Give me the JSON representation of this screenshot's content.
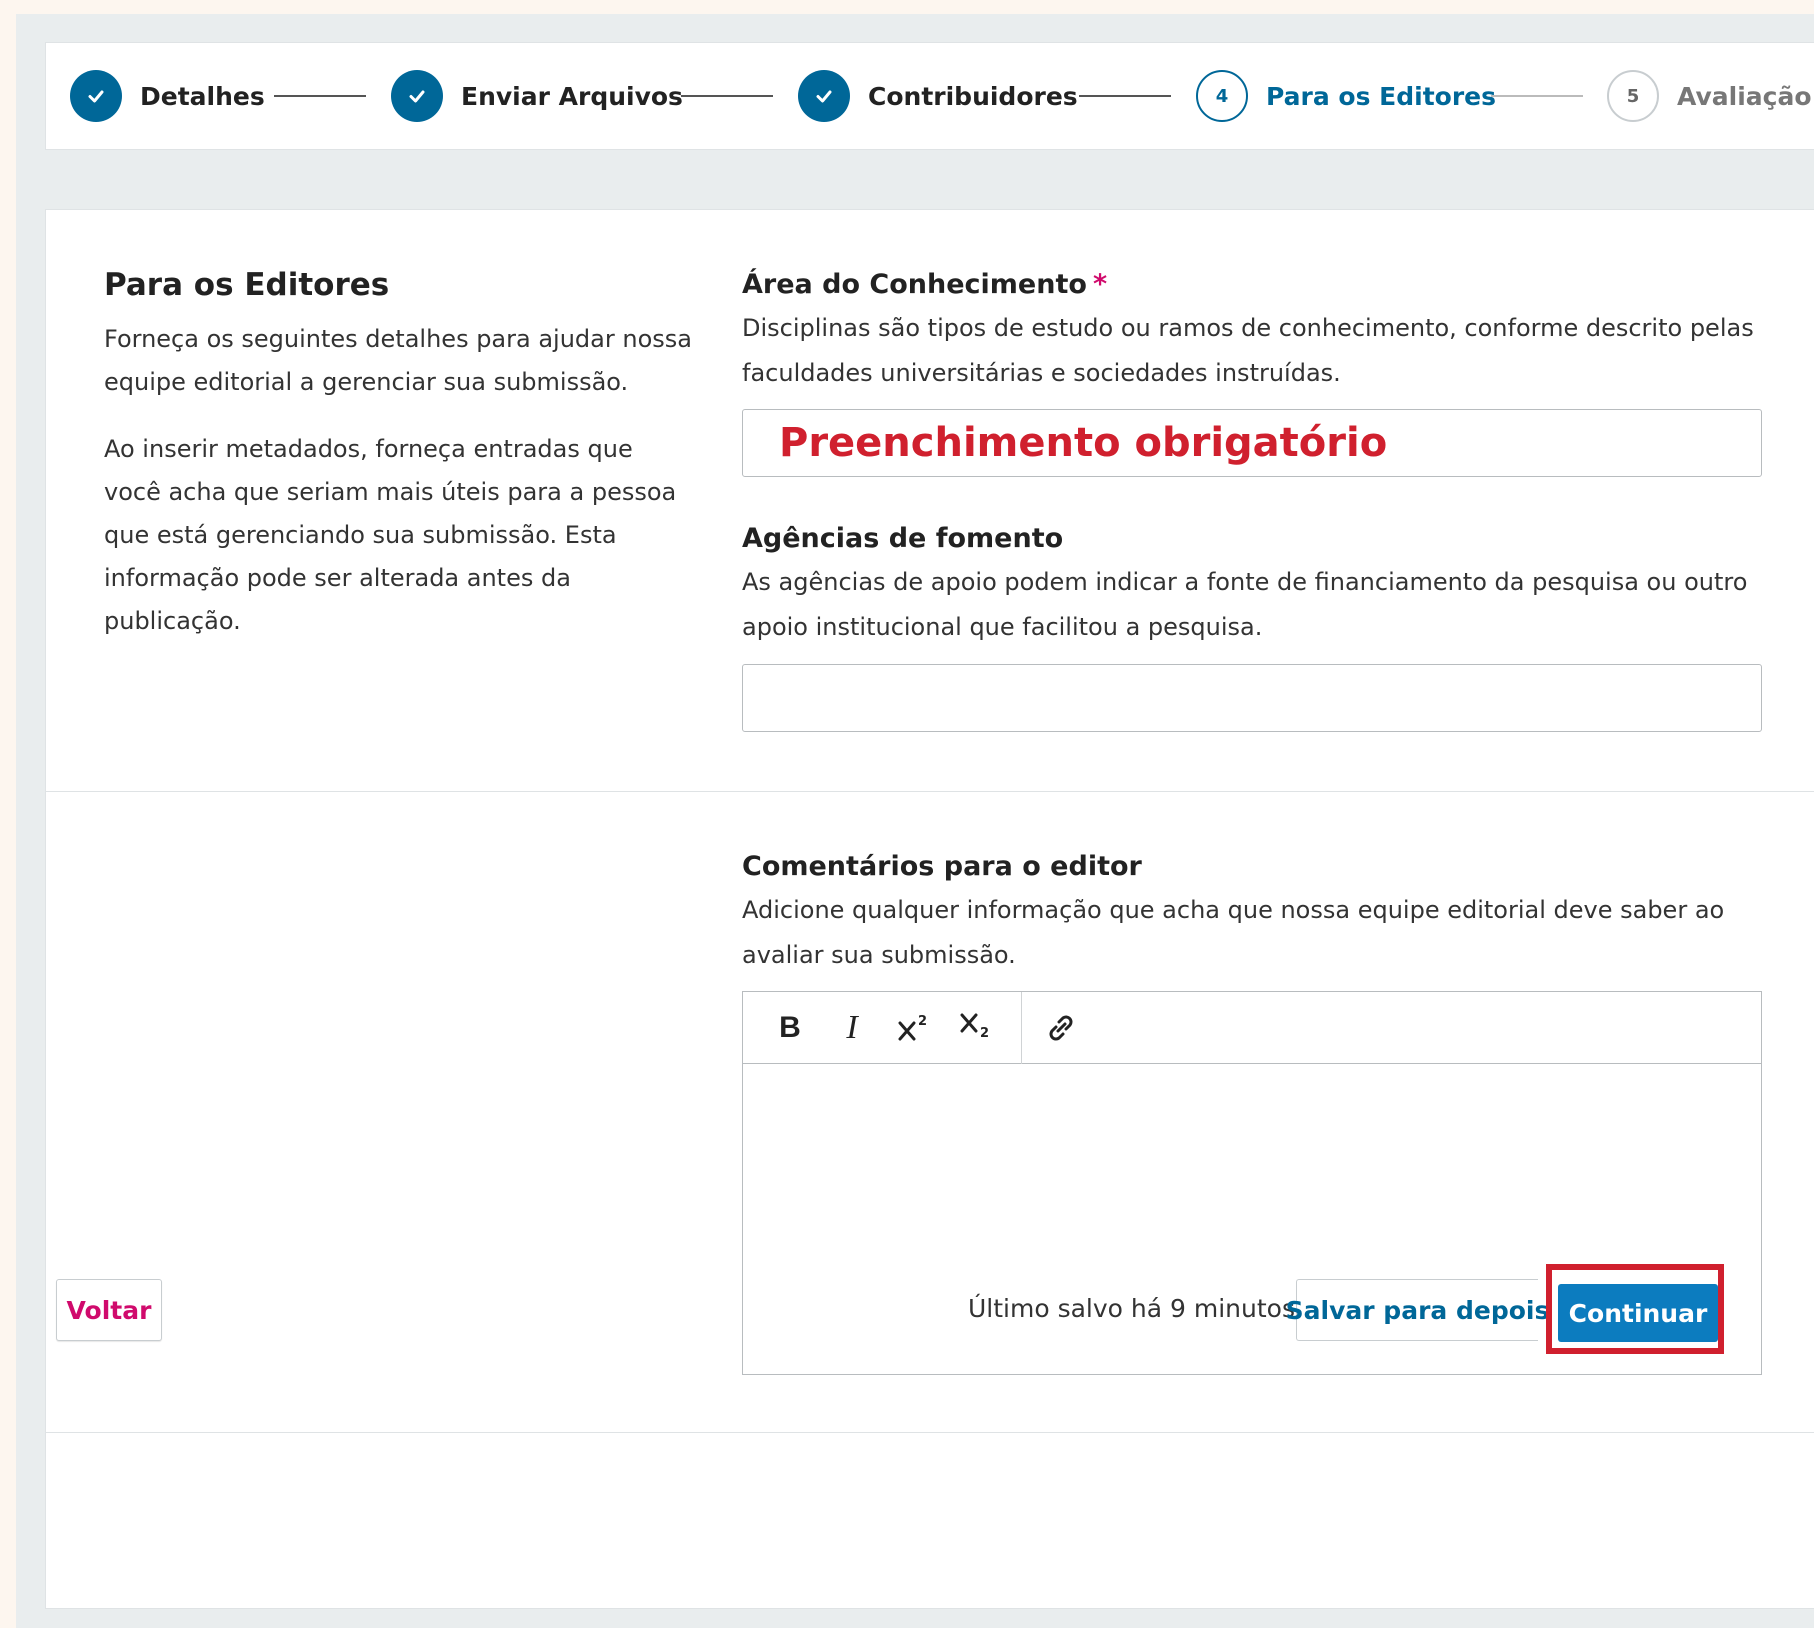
{
  "stepper": {
    "steps": [
      {
        "number": "",
        "label": "Detalhes",
        "state": "done"
      },
      {
        "number": "",
        "label": "Enviar Arquivos",
        "state": "done"
      },
      {
        "number": "",
        "label": "Contribuidores",
        "state": "done"
      },
      {
        "number": "4",
        "label": "Para os Editores",
        "state": "current"
      },
      {
        "number": "5",
        "label": "Avaliação",
        "state": "todo"
      }
    ]
  },
  "intro": {
    "title": "Para os Editores",
    "paragraph1": "Forneça os seguintes detalhes para ajudar nossa equipe editorial a gerenciar sua submissão.",
    "paragraph2": "Ao inserir metadados, forneça entradas que você acha que seriam mais úteis para a pessoa que está gerenciando sua submissão. Esta informação pode ser alterada antes da publicação."
  },
  "fields": {
    "area": {
      "label": "Área do Conhecimento",
      "required_mark": "*",
      "description": "Disciplinas são tipos de estudo ou ramos de conhecimento, conforme descrito pelas faculdades universitárias e sociedades instruídas.",
      "annotation": "Preenchimento obrigatório",
      "value": ""
    },
    "agencias": {
      "label": "Agências de fomento",
      "description": "As agências de apoio podem indicar a fonte de financiamento da pesquisa ou outro apoio institucional que facilitou a pesquisa.",
      "value": ""
    },
    "comentarios": {
      "label": "Comentários para o editor",
      "description": "Adicione qualquer informação que acha que nossa equipe editorial deve saber ao avaliar sua submissão.",
      "toolbar": {
        "bold": "B",
        "italic": "I",
        "superscript_icon": "superscript-icon",
        "subscript_icon": "subscript-icon",
        "link_icon": "link-icon"
      },
      "value": ""
    }
  },
  "footer": {
    "back_label": "Voltar",
    "save_status": "Último salvo há 9 minutos",
    "save_later_label": "Salvar para depois",
    "continue_label": "Continuar"
  },
  "colors": {
    "primary": "#006798",
    "primary_button": "#0c7cbf",
    "accent_pink": "#d00a6c",
    "annotation_red": "#d0202e",
    "page_background": "#e9edee"
  }
}
